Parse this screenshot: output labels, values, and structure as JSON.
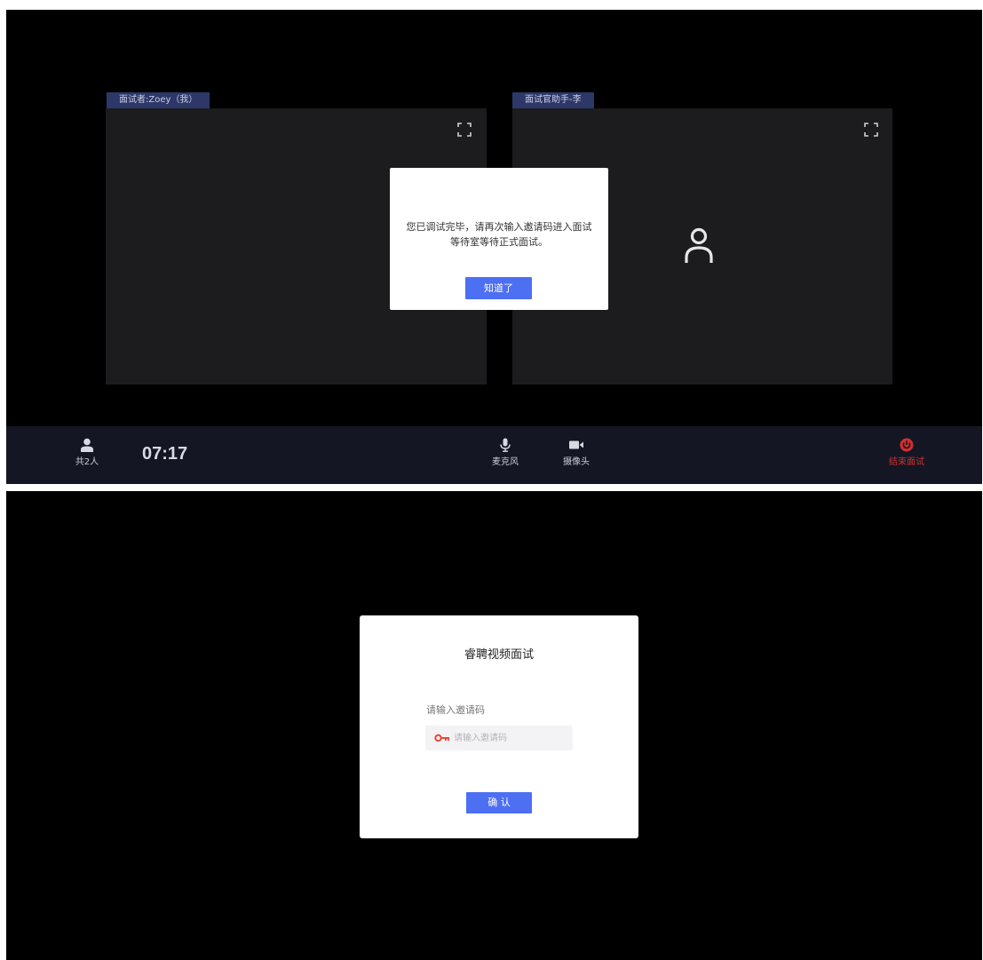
{
  "interview_room": {
    "participants": [
      {
        "tag": "面试者:Zoey（我）"
      },
      {
        "tag": "面试官助手-李"
      }
    ],
    "notice_dialog": {
      "message": "您已调试完毕，请再次输入邀请码进入面试等待室等待正式面试。",
      "confirm_label": "知道了"
    },
    "toolbar": {
      "people_label": "共2人",
      "timer": "07:17",
      "mic_label": "麦克风",
      "camera_label": "摄像头",
      "end_label": "结束面试"
    },
    "colors": {
      "tag_bg": "#2d3868",
      "panel_bg": "#1c1c1e",
      "toolbar_bg": "#141723",
      "accent_blue": "#4d6ff2",
      "end_red": "#d32f2f"
    }
  },
  "login": {
    "title": "睿聘视频面试",
    "field_label": "请输入邀请码",
    "placeholder": "请输入邀请码",
    "value": "",
    "confirm_label": "确 认",
    "key_icon_color": "#f0473a"
  }
}
